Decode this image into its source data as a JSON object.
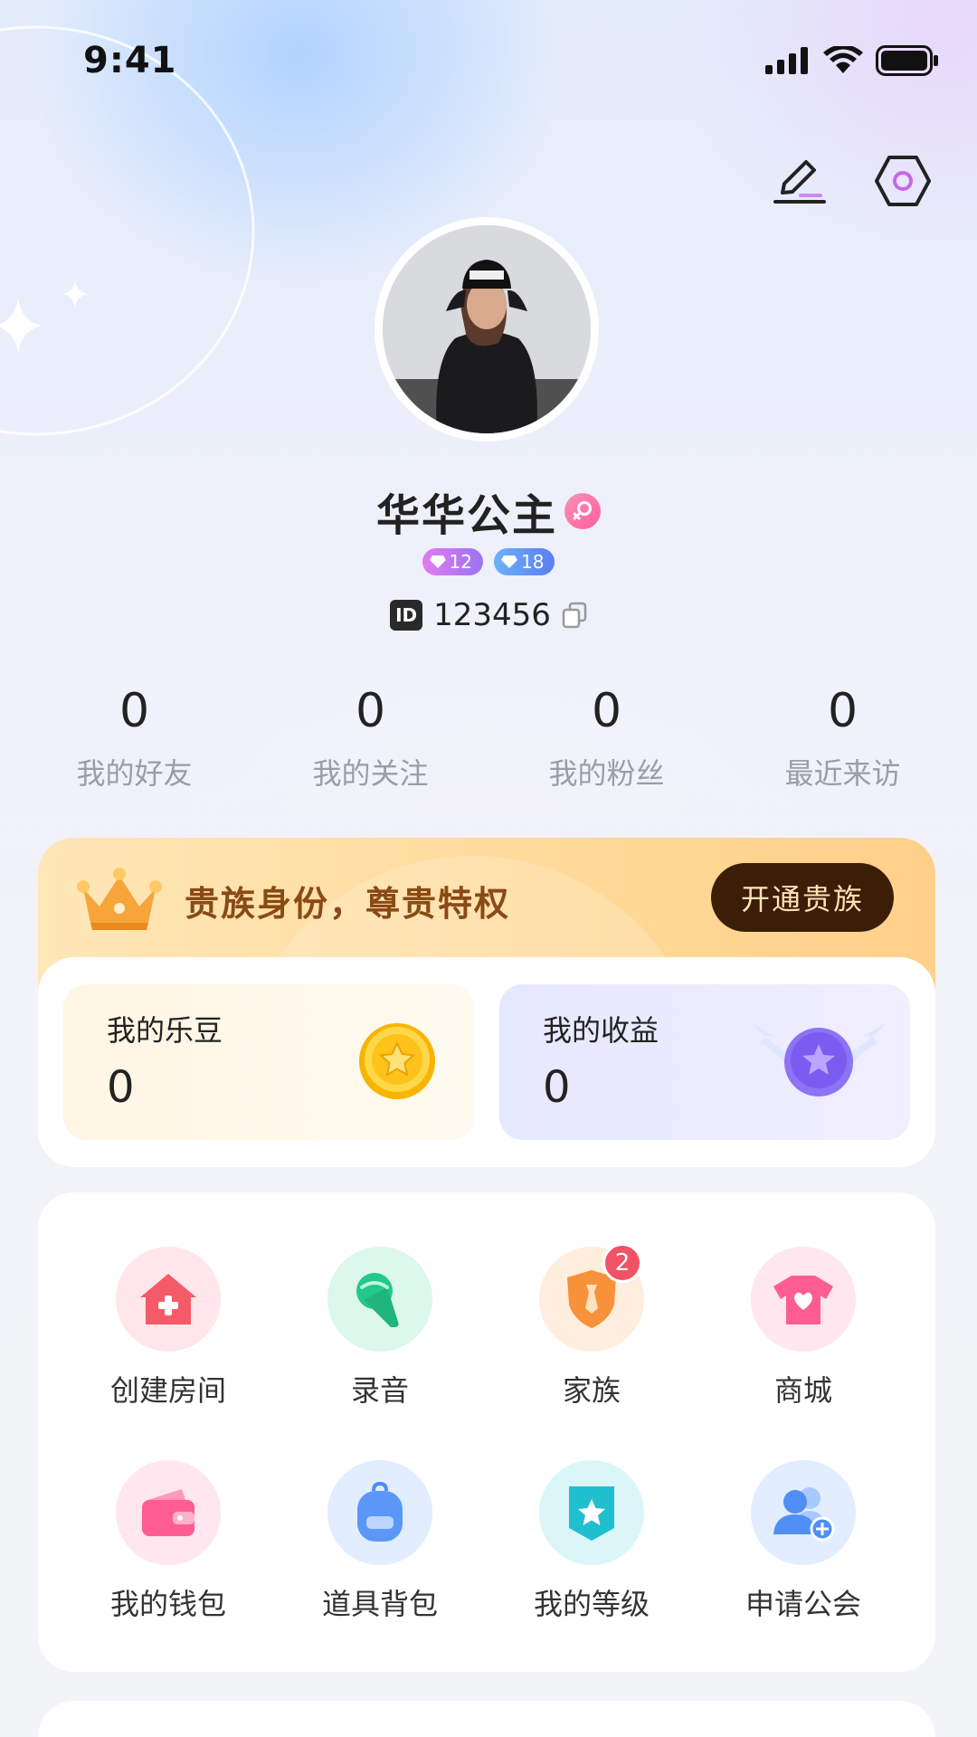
{
  "status_bar": {
    "time": "9:41"
  },
  "profile": {
    "name": "华华公主",
    "gender": "female",
    "badges": [
      {
        "value": "12",
        "color": "purple"
      },
      {
        "value": "18",
        "color": "blue"
      }
    ],
    "id_tag": "ID",
    "id_value": "123456"
  },
  "stats": [
    {
      "value": "0",
      "label": "我的好友"
    },
    {
      "value": "0",
      "label": "我的关注"
    },
    {
      "value": "0",
      "label": "我的粉丝"
    },
    {
      "value": "0",
      "label": "最近来访"
    }
  ],
  "noble": {
    "text": "贵族身份，尊贵特权",
    "button": "开通贵族"
  },
  "wallet": {
    "coins": {
      "label": "我的乐豆",
      "value": "0"
    },
    "income": {
      "label": "我的收益",
      "value": "0"
    }
  },
  "functions": [
    {
      "label": "创建房间",
      "icon": "create-room-icon"
    },
    {
      "label": "录音",
      "icon": "microphone-icon"
    },
    {
      "label": "家族",
      "icon": "family-badge-icon",
      "badge": "2"
    },
    {
      "label": "商城",
      "icon": "shop-shirt-icon"
    },
    {
      "label": "我的钱包",
      "icon": "wallet-icon"
    },
    {
      "label": "道具背包",
      "icon": "backpack-icon"
    },
    {
      "label": "我的等级",
      "icon": "level-star-icon"
    },
    {
      "label": "申请公会",
      "icon": "guild-add-icon"
    }
  ],
  "colors": {
    "accent_pink": "#ff5f9c",
    "noble_button": "#3b1e08",
    "badge_red": "#f25265"
  }
}
